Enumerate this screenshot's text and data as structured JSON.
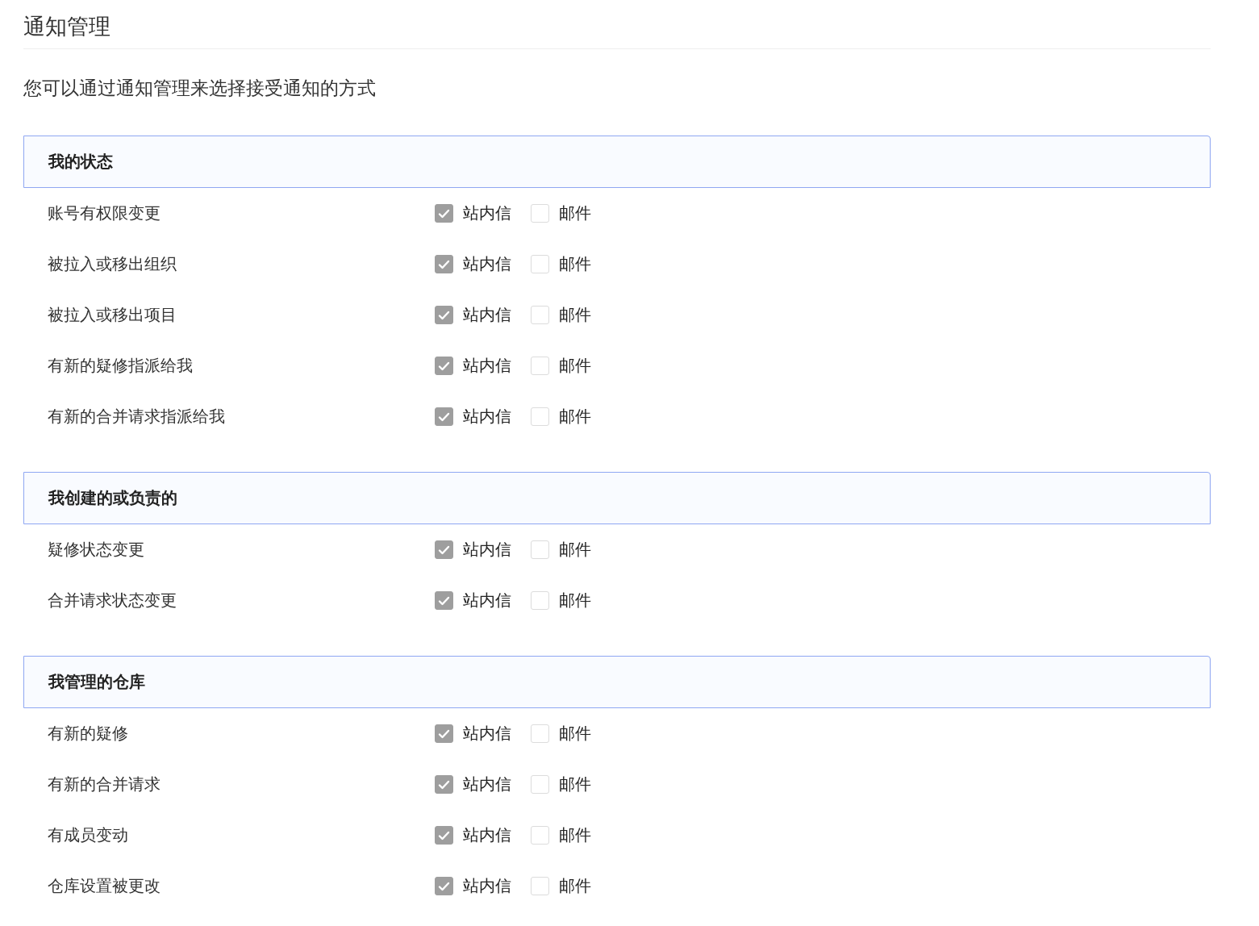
{
  "title": "通知管理",
  "description": "您可以通过通知管理来选择接受通知的方式",
  "sections": [
    {
      "title": "我的状态",
      "items": [
        {
          "label": "账号有权限变更",
          "options": [
            {
              "label": "站内信",
              "checked": true,
              "disabled": true
            },
            {
              "label": "邮件",
              "checked": false,
              "disabled": false
            }
          ]
        },
        {
          "label": "被拉入或移出组织",
          "options": [
            {
              "label": "站内信",
              "checked": true,
              "disabled": true
            },
            {
              "label": "邮件",
              "checked": false,
              "disabled": false
            }
          ]
        },
        {
          "label": "被拉入或移出项目",
          "options": [
            {
              "label": "站内信",
              "checked": true,
              "disabled": true
            },
            {
              "label": "邮件",
              "checked": false,
              "disabled": false
            }
          ]
        },
        {
          "label": "有新的疑修指派给我",
          "options": [
            {
              "label": "站内信",
              "checked": true,
              "disabled": true
            },
            {
              "label": "邮件",
              "checked": false,
              "disabled": false
            }
          ]
        },
        {
          "label": "有新的合并请求指派给我",
          "options": [
            {
              "label": "站内信",
              "checked": true,
              "disabled": true
            },
            {
              "label": "邮件",
              "checked": false,
              "disabled": false
            }
          ]
        }
      ]
    },
    {
      "title": "我创建的或负责的",
      "items": [
        {
          "label": "疑修状态变更",
          "options": [
            {
              "label": "站内信",
              "checked": true,
              "disabled": true
            },
            {
              "label": "邮件",
              "checked": false,
              "disabled": false
            }
          ]
        },
        {
          "label": "合并请求状态变更",
          "options": [
            {
              "label": "站内信",
              "checked": true,
              "disabled": true
            },
            {
              "label": "邮件",
              "checked": false,
              "disabled": false
            }
          ]
        }
      ]
    },
    {
      "title": "我管理的仓库",
      "items": [
        {
          "label": "有新的疑修",
          "options": [
            {
              "label": "站内信",
              "checked": true,
              "disabled": true
            },
            {
              "label": "邮件",
              "checked": false,
              "disabled": false
            }
          ]
        },
        {
          "label": "有新的合并请求",
          "options": [
            {
              "label": "站内信",
              "checked": true,
              "disabled": true
            },
            {
              "label": "邮件",
              "checked": false,
              "disabled": false
            }
          ]
        },
        {
          "label": "有成员变动",
          "options": [
            {
              "label": "站内信",
              "checked": true,
              "disabled": true
            },
            {
              "label": "邮件",
              "checked": false,
              "disabled": false
            }
          ]
        },
        {
          "label": "仓库设置被更改",
          "options": [
            {
              "label": "站内信",
              "checked": true,
              "disabled": true
            },
            {
              "label": "邮件",
              "checked": false,
              "disabled": false
            }
          ]
        }
      ]
    }
  ]
}
